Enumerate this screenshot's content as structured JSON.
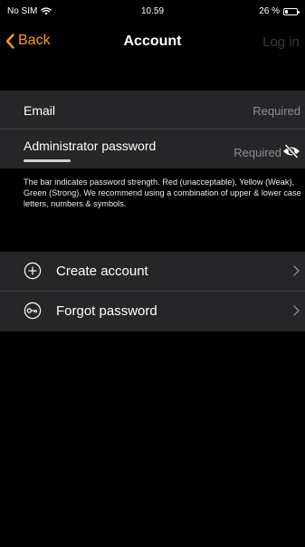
{
  "status_bar": {
    "carrier": "No SIM",
    "time": "10.59",
    "battery_text": "26 %",
    "battery_level": 0.26
  },
  "nav": {
    "back_label": "Back",
    "title": "Account",
    "login_label": "Log in"
  },
  "form": {
    "email_label": "Email",
    "email_value": "Required",
    "password_label": "Administrator password",
    "password_value": "Required"
  },
  "help_text": "The bar indicates password strength. Red (unacceptable), Yellow (Weak), Green (Strong). We recommend using a combination of upper & lower case letters, numbers & symbols.",
  "actions": [
    {
      "label": "Create account",
      "icon": "plus-circle-icon"
    },
    {
      "label": "Forgot password",
      "icon": "key-circle-icon"
    }
  ],
  "colors": {
    "accent": "#f5a00a",
    "background": "#000000",
    "cell": "#262628",
    "placeholder": "#8e8e93",
    "disabled": "#3a3a3c"
  }
}
